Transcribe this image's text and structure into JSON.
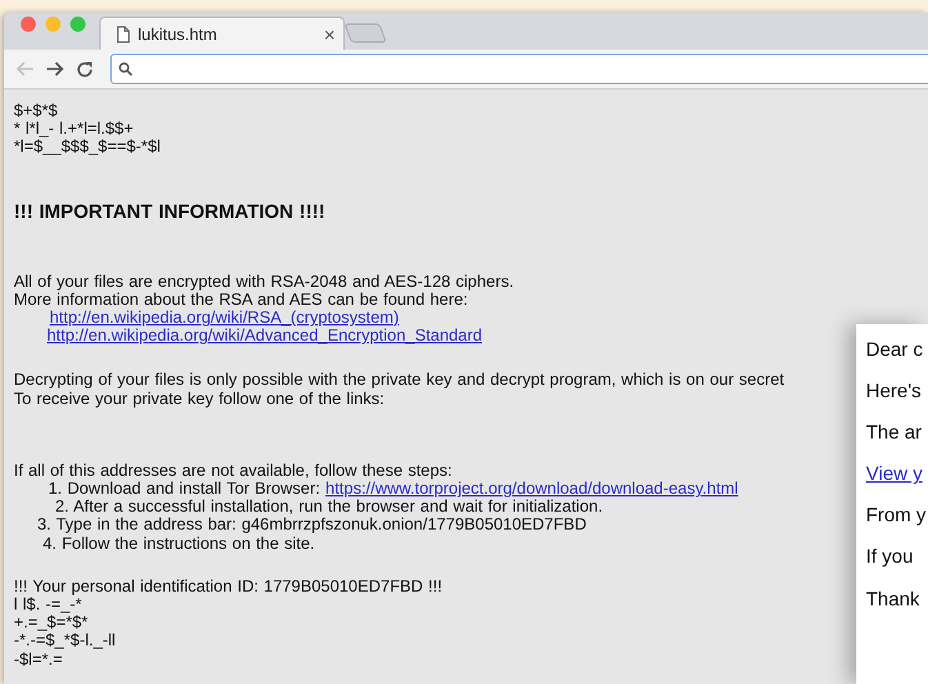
{
  "browser": {
    "tab": {
      "title": "lukitus.htm",
      "close": "×",
      "selected": true
    },
    "back_disabled": true
  },
  "note": {
    "garble_top": [
      "$+$*$",
      "*  l*l_- l.+*l=l.$$+",
      "*l=$__$$$_$==$-*$l"
    ],
    "heading": "!!!  IMPORTANT INFORMATION !!!!",
    "info_lines": [
      "All of your  files are  encrypted  with  RSA-2048 and  AES-128 ciphers.",
      "More information  about the RSA and AES  can be found here:"
    ],
    "info_links": [
      "http://en.wikipedia.org/wiki/RSA_(cryptosystem)",
      "http://en.wikipedia.org/wiki/Advanced_Encryption_Standard"
    ],
    "decrypt_lines": [
      "Decrypting of  your files is  only  possible  with the  private key  and decrypt  program, which is on our secret",
      "To receive  your private key follow  one  of  the  links:"
    ],
    "fallback_intro": "If  all of  this  addresses are not  available, follow  these  steps:",
    "steps": [
      {
        "text": "1. Download  and install  Tor  Browser:",
        "link": "https://www.torproject.org/download/download-easy.html"
      },
      {
        "text": "2.  After  a successful  installation,  run the browser and wait for  initialization."
      },
      {
        "text": "3. Type  in the  address bar: g46mbrrzpfszonuk.onion/1779B05010ED7FBD"
      },
      {
        "text": "4.  Follow the instructions  on  the site."
      }
    ],
    "id_line": "!!!  Your personal identification  ID: 1779B05010ED7FBD !!!",
    "garble_bottom": [
      "l l$.  -=_-*",
      "+.=_$=*$*",
      "-*.-=$_*$-l._-ll",
      "-$l=*.="
    ]
  },
  "mail_card": {
    "lines": [
      {
        "kind": "text",
        "text": "Dear c"
      },
      {
        "kind": "text",
        "text": "Here's"
      },
      {
        "kind": "text",
        "text": "The ar"
      },
      {
        "kind": "link",
        "text": "View y"
      },
      {
        "kind": "text",
        "text": "From y"
      },
      {
        "kind": "text",
        "text": "If you"
      },
      {
        "kind": "text",
        "text": "Thank"
      }
    ]
  }
}
